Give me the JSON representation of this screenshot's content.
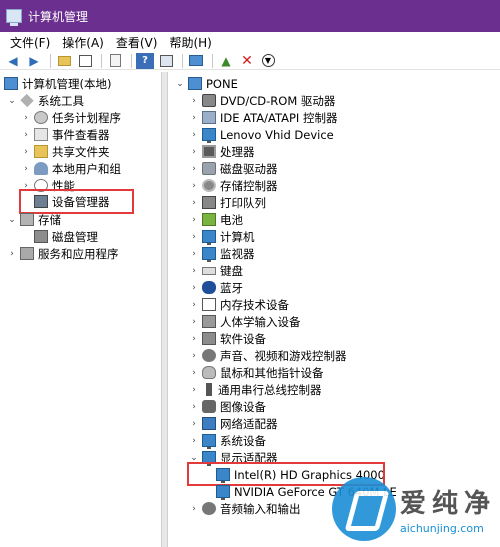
{
  "window": {
    "title": "计算机管理"
  },
  "menu": [
    "文件(F)",
    "操作(A)",
    "查看(V)",
    "帮助(H)"
  ],
  "toolbar_icons": [
    "back-arrow-icon",
    "forward-arrow-icon",
    "up-folder-icon",
    "show-tree-icon",
    "properties-icon",
    "help-icon",
    "view-icon",
    "monitor-icon",
    "add-driver-icon",
    "uninstall-icon",
    "download-icon"
  ],
  "left_tree": {
    "root": "计算机管理(本地)",
    "system_tools": "系统工具",
    "items": [
      "任务计划程序",
      "事件查看器",
      "共享文件夹",
      "本地用户和组",
      "性能",
      "设备管理器"
    ],
    "storage": "存储",
    "disk_mgmt": "磁盘管理",
    "services": "服务和应用程序"
  },
  "right_tree": {
    "root": "PONE",
    "categories": [
      "DVD/CD-ROM 驱动器",
      "IDE ATA/ATAPI 控制器",
      "Lenovo Vhid Device",
      "处理器",
      "磁盘驱动器",
      "存储控制器",
      "打印队列",
      "电池",
      "计算机",
      "监视器",
      "键盘",
      "蓝牙",
      "内存技术设备",
      "人体学输入设备",
      "软件设备",
      "声音、视频和游戏控制器",
      "鼠标和其他指针设备",
      "通用串行总线控制器",
      "图像设备",
      "网络适配器",
      "系统设备",
      "显示适配器"
    ],
    "display_children": [
      "Intel(R) HD Graphics 4000",
      "NVIDIA GeForce GT 640M LE"
    ],
    "last": "音频输入和输出"
  },
  "watermark": {
    "cn": "爱纯净",
    "url": "aichunjing.com"
  },
  "colors": {
    "titlebar": "#6a2f8f",
    "highlight": "#e23a3a"
  }
}
